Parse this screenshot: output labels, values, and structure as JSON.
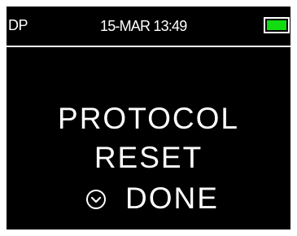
{
  "status_bar": {
    "mode": "DP",
    "datetime": "15-MAR 13:49",
    "battery_level": 1.0,
    "battery_color": "#11dd11"
  },
  "message": {
    "line1": "PROTOCOL",
    "line2": "RESET"
  },
  "done_action": {
    "icon": "circle-down-arrow-icon",
    "label": "DONE"
  }
}
